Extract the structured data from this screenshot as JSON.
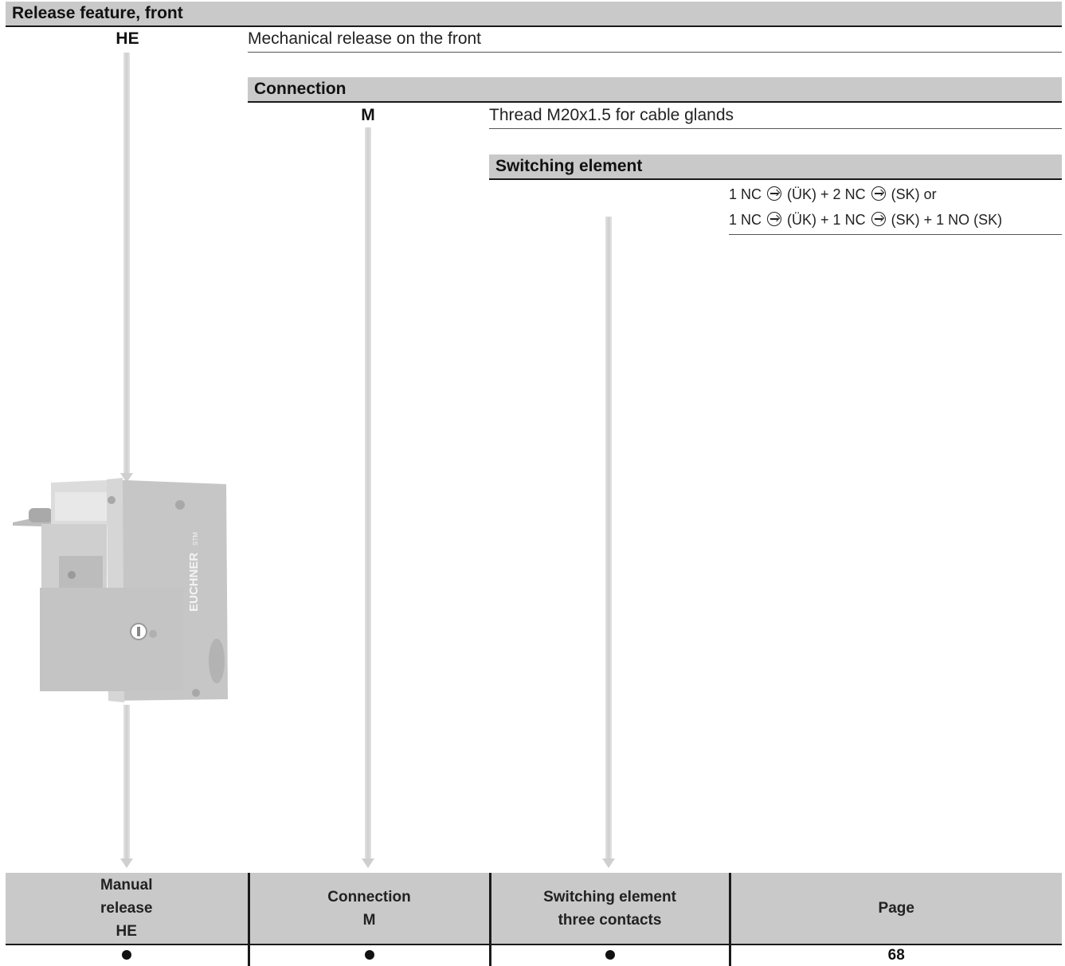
{
  "release": {
    "header": "Release feature, front",
    "code": "HE",
    "description": "Mechanical release on the front"
  },
  "connection": {
    "header": "Connection",
    "code": "M",
    "description": "Thread M20x1.5 for cable glands"
  },
  "switching": {
    "header": "Switching element",
    "line1_a": "1 NC",
    "line1_b": "(ÜK) + 2 NC",
    "line1_c": "(SK) or",
    "line2_a": "1 NC",
    "line2_b": "(ÜK) + 1 NC",
    "line2_c": "(SK) + 1 NO (SK)"
  },
  "product": {
    "brand": "EUCHNER",
    "model": "STM"
  },
  "summary_table": {
    "col1_l1": "Manual",
    "col1_l2": "release",
    "col1_l3": "HE",
    "col2_l1": "Connection",
    "col2_l2": "M",
    "col3_l1": "Switching element",
    "col3_l2": "three contacts",
    "col4": "Page",
    "page": "68"
  }
}
